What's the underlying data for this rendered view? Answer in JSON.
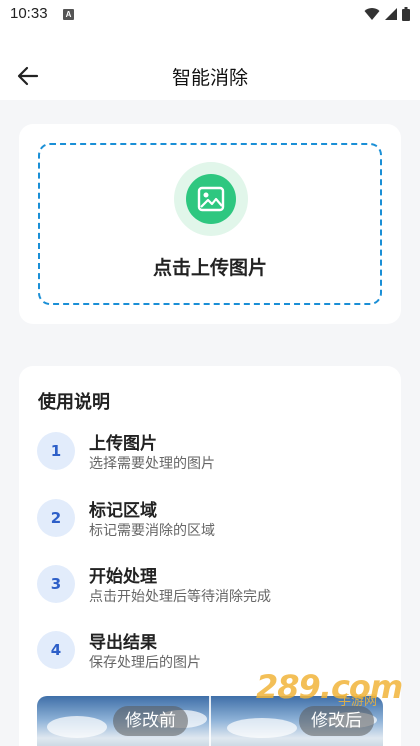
{
  "status_bar": {
    "time": "10:33",
    "notification_letter": "A"
  },
  "header": {
    "title": "智能消除"
  },
  "upload": {
    "label": "点击上传图片"
  },
  "guide": {
    "title": "使用说明",
    "steps": [
      {
        "num": "1",
        "title": "上传图片",
        "desc": "选择需要处理的图片"
      },
      {
        "num": "2",
        "title": "标记区域",
        "desc": "标记需要消除的区域"
      },
      {
        "num": "3",
        "title": "开始处理",
        "desc": "点击开始处理后等待消除完成"
      },
      {
        "num": "4",
        "title": "导出结果",
        "desc": "保存处理后的图片"
      }
    ],
    "compare": {
      "before_label": "修改前",
      "after_label": "修改后"
    }
  },
  "watermark": {
    "main": "289.com",
    "sub": "手游网"
  },
  "colors": {
    "accent_dashed_border": "#1a8fd6",
    "upload_icon": "#2ec780",
    "step_badge_text": "#2d5fc8",
    "watermark": "#f1b53a"
  }
}
